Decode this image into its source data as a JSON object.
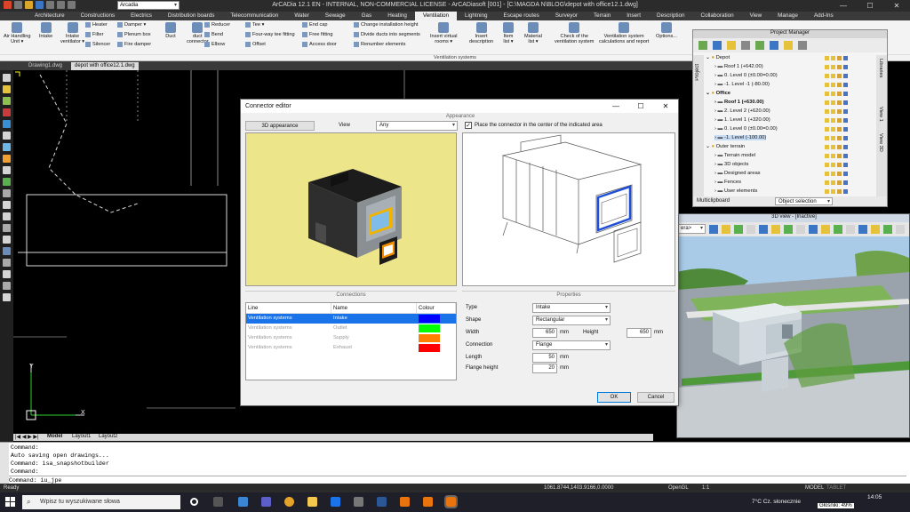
{
  "window": {
    "title": "ArCADia 12.1 EN - INTERNAL, NON-COMMERCIAL LICENSE - ArCADiasoft [001] - [C:\\MAGDA N\\BLOG\\depot with office12.1.dwg]",
    "workspace_combo": "Arcadia",
    "controls": [
      "—",
      "☐",
      "✕"
    ]
  },
  "menu": {
    "tabs": [
      "Architecture",
      "Constructions",
      "Electrics",
      "Distribution boards",
      "Telecommunication",
      "Water",
      "Sewage",
      "Gas",
      "Heating",
      "Ventilation",
      "Lightning",
      "Escape routes",
      "Surveyor",
      "Terrain",
      "Insert",
      "Description",
      "Collaboration",
      "View",
      "Manage",
      "Add-Ins"
    ],
    "active": "Ventilation"
  },
  "ribbon": {
    "group_label": "Ventilation systems",
    "large": [
      {
        "label": "Air Handling\nUnit ▾"
      },
      {
        "label": "Intake"
      },
      {
        "label": "Intake\nventilator ▾"
      },
      {
        "label": "Duct"
      },
      {
        "label": "duct\nconnector"
      },
      {
        "label": "Insert virtual\nrooms ▾"
      },
      {
        "label": "Insert\ndescription"
      },
      {
        "label": "Item\nlist ▾"
      },
      {
        "label": "Material\nlist ▾"
      },
      {
        "label": "Check of the\nventilation system"
      },
      {
        "label": "Ventilation system\ncalculations and report"
      },
      {
        "label": "Options..."
      }
    ],
    "small": [
      "Heater",
      "Filter",
      "Silencer",
      "Damper ▾",
      "Plenum box",
      "Fire damper",
      "Reducer",
      "Bend",
      "Elbow",
      "Tee ▾",
      "Four-way tee fitting",
      "Offset",
      "End cap",
      "Free fitting",
      "Access door",
      "Change installation height",
      "Divide ducts into segments",
      "Renumber elements"
    ]
  },
  "doc_tabs": [
    "Drawing1.dwg",
    "depot with office12.1.dwg"
  ],
  "layout_tabs": [
    "Model",
    "Layout1",
    "Layout2"
  ],
  "axis": {
    "y": "Y",
    "x": "X"
  },
  "command": {
    "lines": [
      "Command:",
      "Auto saving open drawings...",
      "Command: isa_snapshotbuilder",
      "Command:"
    ],
    "input": "Command: iu_jpe"
  },
  "status": {
    "left": "Ready",
    "coords": "1061.8744,1403.9166,0.0000",
    "render": "OpenGL",
    "scale": "1:1",
    "model": "MODEL",
    "tablet": "TABLET"
  },
  "taskbar": {
    "search_placeholder": "Wpisz tu wyszukiwane słowa",
    "weather": "7°C  Cz. słonecznie",
    "time": "14:05",
    "volume_tooltip": "Głośniki: 49%"
  },
  "project_manager": {
    "title": "Project Manager",
    "rows": [
      {
        "label": "Depot",
        "level": 0,
        "bold": false
      },
      {
        "label": "Roof 1 (+642.00)",
        "level": 1
      },
      {
        "label": "0. Level 0 (±0.00=0.00)",
        "level": 1
      },
      {
        "label": "-1. Level -1 (-80.00)",
        "level": 1
      },
      {
        "label": "Office",
        "level": 0,
        "bold": true
      },
      {
        "label": "Roof 1 (+630.00)",
        "level": 1,
        "bold": true
      },
      {
        "label": "2. Level 2 (+620.00)",
        "level": 1
      },
      {
        "label": "1. Level 1 (+320.00)",
        "level": 1
      },
      {
        "label": "0. Level 0 (±0.00=0.00)",
        "level": 1
      },
      {
        "label": "-1. Level (-100.00)",
        "level": 1,
        "selected": true
      },
      {
        "label": "Outer terrain",
        "level": 0
      },
      {
        "label": "Terrain model",
        "level": 1
      },
      {
        "label": "3D objects",
        "level": 1
      },
      {
        "label": "Designed areas",
        "level": 1
      },
      {
        "label": "Fences",
        "level": 1
      },
      {
        "label": "User elements",
        "level": 1
      }
    ],
    "left_tabs": "Project",
    "right_tabs": [
      "Libraries",
      "View 1",
      "View 3D"
    ],
    "footer_left": "Multiclipboard",
    "footer_button": "Object selection"
  },
  "view3d": {
    "title": "3D view - [Inactive]",
    "combo": "era>"
  },
  "dialog": {
    "title": "Connector editor",
    "appearance_section": "Appearance",
    "btn_3d": "3D appearance",
    "view_label": "View",
    "view_value": "Any",
    "checkbox_label": "Place the connector in the center of the indicated area",
    "checkbox_checked": true,
    "connections_section": "Connections",
    "properties_section": "Properties",
    "table_headers": [
      "Line",
      "Name",
      "Colour"
    ],
    "connections": [
      {
        "line": "Ventilation systems",
        "name": "Intake",
        "color": "#0000ff",
        "selected": true
      },
      {
        "line": "Ventilation systems",
        "name": "Outlet",
        "color": "#00ff00"
      },
      {
        "line": "Ventilation systems",
        "name": "Supply",
        "color": "#ff8000"
      },
      {
        "line": "Ventilation systems",
        "name": "Exhaust",
        "color": "#ff0000"
      }
    ],
    "props": {
      "type_label": "Type",
      "type_value": "Intake",
      "shape_label": "Shape",
      "shape_value": "Rectangular",
      "width_label": "Width",
      "width_value": "650",
      "width_unit": "mm",
      "height_label": "Height",
      "height_value": "650",
      "height_unit": "mm",
      "connection_label": "Connection",
      "connection_value": "Flange",
      "length_label": "Length",
      "length_value": "50",
      "length_unit": "mm",
      "flange_label": "Flange height",
      "flange_value": "20",
      "flange_unit": "mm"
    },
    "ok": "OK",
    "cancel": "Cancel"
  }
}
